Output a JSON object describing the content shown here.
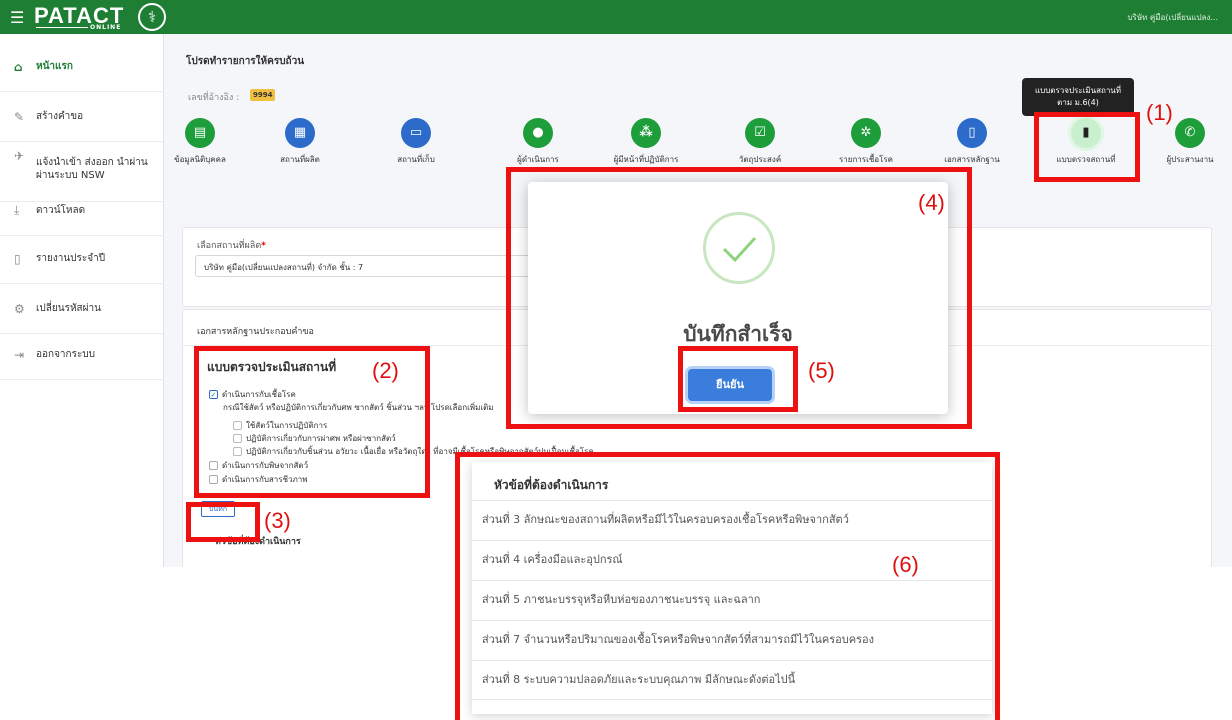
{
  "header": {
    "logo_text": "PATACT",
    "logo_sub": "ONLINE",
    "user_name": "บริษัท คู่มือ(เปลี่ยนแปลง..."
  },
  "sidebar": {
    "items": [
      {
        "label": "หน้าแรก",
        "icon": "home-icon"
      },
      {
        "label": "สร้างคำขอ",
        "icon": "pencil-icon"
      },
      {
        "label": "แจ้งนำเข้า ส่งออก นำผ่าน ผ่านระบบ NSW",
        "icon": "plane-icon"
      },
      {
        "label": "ดาวน์โหลด",
        "icon": "download-icon"
      },
      {
        "label": "รายงานประจำปี",
        "icon": "file-icon"
      },
      {
        "label": "เปลี่ยนรหัสผ่าน",
        "icon": "gears-icon"
      },
      {
        "label": "ออกจากระบบ",
        "icon": "logout-icon"
      }
    ]
  },
  "main": {
    "title": "โปรดทำรายการให้ครบถ้วน",
    "ref_label": "เลขที่อ้างอิง :",
    "ref_value": "9994",
    "steps": [
      {
        "label": "ข้อมูลนิติบุคคล",
        "icon": "id-card-icon",
        "color": "#1e9e3a"
      },
      {
        "label": "สถานที่ผลิต",
        "icon": "building-icon",
        "color": "#2c6bc9"
      },
      {
        "label": "สถานที่เก็บ",
        "icon": "archive-icon",
        "color": "#2c6bc9"
      },
      {
        "label": "ผู้ดำเนินการ",
        "icon": "user-icon",
        "color": "#1e9e3a"
      },
      {
        "label": "ผู้มีหน้าที่ปฏิบัติการ",
        "icon": "users-icon",
        "color": "#1e9e3a"
      },
      {
        "label": "วัตถุประสงค์",
        "icon": "check-square-icon",
        "color": "#1e9e3a"
      },
      {
        "label": "รายการเชื้อโรค",
        "icon": "virus-icon",
        "color": "#1e9e3a"
      },
      {
        "label": "เอกสารหลักฐาน",
        "icon": "document-icon",
        "color": "#2c6bc9"
      },
      {
        "label": "แบบตรวจสถานที่",
        "icon": "clipboard-icon",
        "color": "#222222"
      },
      {
        "label": "ผู้ประสานงาน",
        "icon": "phone-icon",
        "color": "#1e9e3a"
      }
    ],
    "tooltip": {
      "line1": "แบบตรวจประเมินสถานที่",
      "line2": "ตาม ม.6(4)"
    },
    "select_label": "เลือกสถานที่ผลิต",
    "select_value": "บริษัท คู่มือ(เปลี่ยนแปลงสถานที่) จำกัด ชั้น : 7",
    "docs_header": "เอกสารหลักฐานประกอบคำขอ",
    "form_title": "แบบตรวจประเมินสถานที่",
    "checkboxes": [
      {
        "label": "ดำเนินการกับเชื้อโรค",
        "checked": true
      },
      {
        "label": "ใช้สัตว์ในการปฏิบัติการ",
        "checked": false
      },
      {
        "label": "ปฏิบัติการเกี่ยวกับการผ่าศพ หรือผ่าซากสัตว์",
        "checked": false
      },
      {
        "label": "ปฏิบัติการเกี่ยวกับชิ้นส่วน อวัยวะ เนื้อเยื่อ หรือวัตถุใดๆ ที่อาจมีเชื้อโรคหรือพิษจากสัตว์ปนเปื้อนเชื้อโรค",
        "checked": false
      },
      {
        "label": "ดำเนินการกับพิษจากสัตว์",
        "checked": false
      },
      {
        "label": "ดำเนินการกับสารชีวภาพ",
        "checked": false
      }
    ],
    "note": "กรณีใช้สัตว์ หรือปฏิบัติการเกี่ยวกับศพ ซากสัตว์ ชิ้นส่วน ฯลฯ โปรดเลือกเพิ่มเติม",
    "save_label": "บันทึก",
    "sub_title": "หัวข้อที่ต้องดำเนินการ"
  },
  "modal": {
    "message": "บันทึกสำเร็จ",
    "confirm_label": "ยืนยัน"
  },
  "panel": {
    "title": "หัวข้อที่ต้องดำเนินการ",
    "items": [
      "ส่วนที่ 3 ลักษณะของสถานที่ผลิตหรือมีไว้ในครอบครองเชื้อโรคหรือพิษจากสัตว์",
      "ส่วนที่ 4 เครื่องมือและอุปกรณ์",
      "ส่วนที่ 5 ภาชนะบรรจุหรือหีบห่อของภาชนะบรรจุ และฉลาก",
      "ส่วนที่ 7 จำนวนหรือปริมาณของเชื้อโรคหรือพิษจากสัตว์ที่สามารถมีไว้ในครอบครอง",
      "ส่วนที่ 8 ระบบความปลอดภัยและระบบคุณภาพ มีลักษณะดังต่อไปนี้"
    ]
  },
  "callouts": [
    "(1)",
    "(2)",
    "(3)",
    "(4)",
    "(5)",
    "(6)"
  ]
}
